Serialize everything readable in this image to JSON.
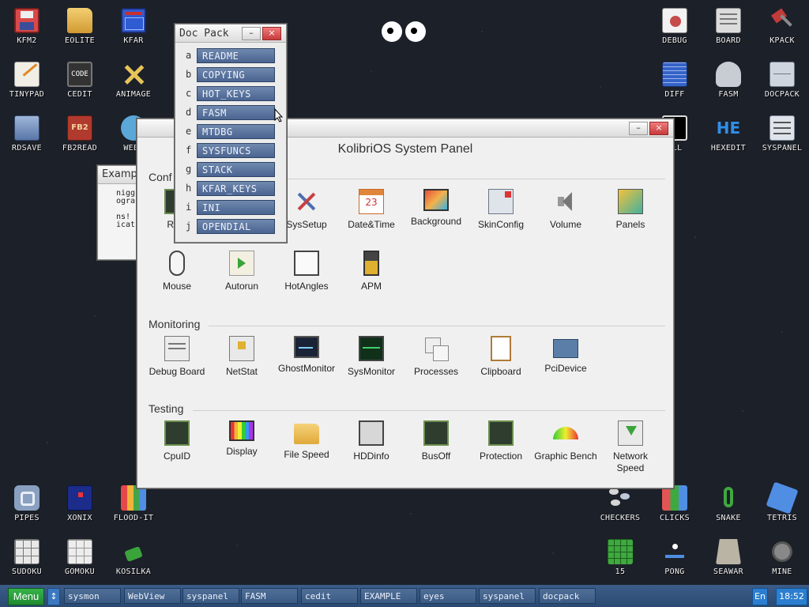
{
  "desktop": {
    "icons": [
      {
        "id": "kfm2",
        "label": "KFM2",
        "icon": "floppy-icon",
        "color": "#d84a4a"
      },
      {
        "id": "eolite",
        "label": "EOLITE",
        "icon": "folder-icon",
        "color": "#e3b04b"
      },
      {
        "id": "kfar",
        "label": "KFAR",
        "icon": "kfar-icon",
        "color": "#2f5bd3"
      },
      {
        "id": "tinypad",
        "label": "TINYPAD",
        "icon": "notepad-icon",
        "color": "#f1efe5"
      },
      {
        "id": "cedit",
        "label": "CEDIT",
        "icon": "code-icon",
        "color": "#333333"
      },
      {
        "id": "animage",
        "label": "ANIMAGE",
        "icon": "pencil-icon",
        "color": "#e7c45a"
      },
      {
        "id": "rdsave",
        "label": "RDSAVE",
        "icon": "rdsave-icon",
        "color": "#6a8cc4"
      },
      {
        "id": "fb2read",
        "label": "FB2READ",
        "icon": "book-icon",
        "color": "#b03a2e"
      },
      {
        "id": "webview",
        "label": "WEBV",
        "icon": "globe-icon",
        "color": "#5aa7d8"
      },
      {
        "id": "debug",
        "label": "DEBUG",
        "icon": "bug-icon",
        "color": "#c64b4b"
      },
      {
        "id": "board",
        "label": "BOARD",
        "icon": "board-icon",
        "color": "#dcdcdc"
      },
      {
        "id": "kpack",
        "label": "KPACK",
        "icon": "hammer-icon",
        "color": "#c33a3a"
      },
      {
        "id": "diff",
        "label": "DIFF",
        "icon": "diff-icon",
        "color": "#3463c7"
      },
      {
        "id": "fasm",
        "label": "FASM",
        "icon": "fasm-icon",
        "color": "#c8ccd3"
      },
      {
        "id": "docpack",
        "label": "DOCPACK",
        "icon": "cabinet-icon",
        "color": "#cfd5de"
      },
      {
        "id": "shell",
        "label": "ELL",
        "icon": "shell-icon",
        "color": "#000000"
      },
      {
        "id": "hexedit",
        "label": "HEXEDIT",
        "icon": "hex-icon",
        "color": "#2f8fe8"
      },
      {
        "id": "syspanel",
        "label": "SYSPANEL",
        "icon": "sliders-icon",
        "color": "#dfe4ea"
      },
      {
        "id": "pipes",
        "label": "PIPES",
        "icon": "pipes-icon",
        "color": "#8aa0c0"
      },
      {
        "id": "xonix",
        "label": "XONIX",
        "icon": "xonix-icon",
        "color": "#1b2c8a"
      },
      {
        "id": "floodit",
        "label": "FLOOD-IT",
        "icon": "grid-color-icon",
        "color": "#e54848"
      },
      {
        "id": "sudoku",
        "label": "SUDOKU",
        "icon": "sudoku-icon",
        "color": "#e8e8e8"
      },
      {
        "id": "gomoku",
        "label": "GOMOKU",
        "icon": "gomoku-icon",
        "color": "#ededed"
      },
      {
        "id": "kosilka",
        "label": "KOSILKA",
        "icon": "mower-icon",
        "color": "#3aa33a"
      },
      {
        "id": "checkers",
        "label": "CHECKERS",
        "icon": "checkers-icon",
        "color": "#d6d6d6"
      },
      {
        "id": "clicks",
        "label": "CLICKS",
        "icon": "clicks-icon",
        "color": "#e35555"
      },
      {
        "id": "snake",
        "label": "SNAKE",
        "icon": "snake-icon",
        "color": "#3fa83f"
      },
      {
        "id": "tetris",
        "label": "TETRIS",
        "icon": "tetris-icon",
        "color": "#4f8ee3"
      },
      {
        "id": "fifteen",
        "label": "15",
        "icon": "fifteen-icon",
        "color": "#3fa83f"
      },
      {
        "id": "pong",
        "label": "PONG",
        "icon": "pong-icon",
        "color": "#4f8ee3"
      },
      {
        "id": "seawar",
        "label": "SEAWAR",
        "icon": "ship-icon",
        "color": "#b9b4a4"
      },
      {
        "id": "mine",
        "label": "MINE",
        "icon": "mine-icon",
        "color": "#888888"
      }
    ]
  },
  "docpack": {
    "title": "Doc Pack",
    "items": [
      {
        "key": "a",
        "label": "README"
      },
      {
        "key": "b",
        "label": "COPYING"
      },
      {
        "key": "c",
        "label": "HOT_KEYS"
      },
      {
        "key": "d",
        "label": "FASM"
      },
      {
        "key": "e",
        "label": "MTDBG"
      },
      {
        "key": "f",
        "label": "SYSFUNCS"
      },
      {
        "key": "g",
        "label": "STACK"
      },
      {
        "key": "h",
        "label": "KFAR_KEYS"
      },
      {
        "key": "i",
        "label": "INI"
      },
      {
        "key": "j",
        "label": "OPENDIAL"
      }
    ]
  },
  "example": {
    "title": "Examp",
    "lines": "nigg\nogra\n\nns!\nicat"
  },
  "syspanel": {
    "title": "KolibriOS System Panel",
    "sections": {
      "config": {
        "title": "Conf",
        "items": [
          {
            "label": "Ram",
            "icon": "chip-icon"
          },
          {
            "label": "SysSetup",
            "icon": "tools-icon"
          },
          {
            "label": "Date&Time",
            "icon": "calendar-icon",
            "day": "23"
          },
          {
            "label": "Background",
            "icon": "monitor-icon"
          },
          {
            "label": "SkinConfig",
            "icon": "skin-icon"
          },
          {
            "label": "Volume",
            "icon": "speaker-icon"
          },
          {
            "label": "Panels",
            "icon": "panels-icon"
          },
          {
            "label": "Mouse",
            "icon": "mouse-icon"
          },
          {
            "label": "Autorun",
            "icon": "scroll-icon"
          },
          {
            "label": "HotAngles",
            "icon": "hotangles-icon"
          },
          {
            "label": "APM",
            "icon": "battery-icon"
          }
        ]
      },
      "monitoring": {
        "title": "Monitoring",
        "items": [
          {
            "label": "Debug Board",
            "icon": "board-icon"
          },
          {
            "label": "NetStat",
            "icon": "network-icon"
          },
          {
            "label": "GhostMonitor",
            "icon": "ghost-monitor-icon"
          },
          {
            "label": "SysMonitor",
            "icon": "sysmonitor-icon"
          },
          {
            "label": "Processes",
            "icon": "processes-icon"
          },
          {
            "label": "Clipboard",
            "icon": "clipboard-icon"
          },
          {
            "label": "PciDevice",
            "icon": "pci-icon"
          }
        ]
      },
      "testing": {
        "title": "Testing",
        "items": [
          {
            "label": "CpuID",
            "icon": "chip-icon"
          },
          {
            "label": "Display",
            "icon": "display-icon"
          },
          {
            "label": "File Speed",
            "icon": "folder-icon"
          },
          {
            "label": "HDDinfo",
            "icon": "hdd-icon"
          },
          {
            "label": "BusOff",
            "icon": "chip-icon"
          },
          {
            "label": "Protection",
            "icon": "chip-icon"
          },
          {
            "label": "Graphic Bench",
            "icon": "gauge-icon"
          },
          {
            "label": "Network Speed",
            "icon": "download-icon"
          }
        ]
      }
    }
  },
  "taskbar": {
    "menu_label": "Menu",
    "swap_label": "↕",
    "tasks": [
      "sysmon",
      "WebView",
      "syspanel",
      "FASM",
      "cedit",
      "EXAMPLE",
      "eyes",
      "syspanel",
      "docpack"
    ],
    "lang": "En",
    "clock": "18:52"
  },
  "window_buttons": {
    "minimize": "–",
    "close": "×"
  }
}
